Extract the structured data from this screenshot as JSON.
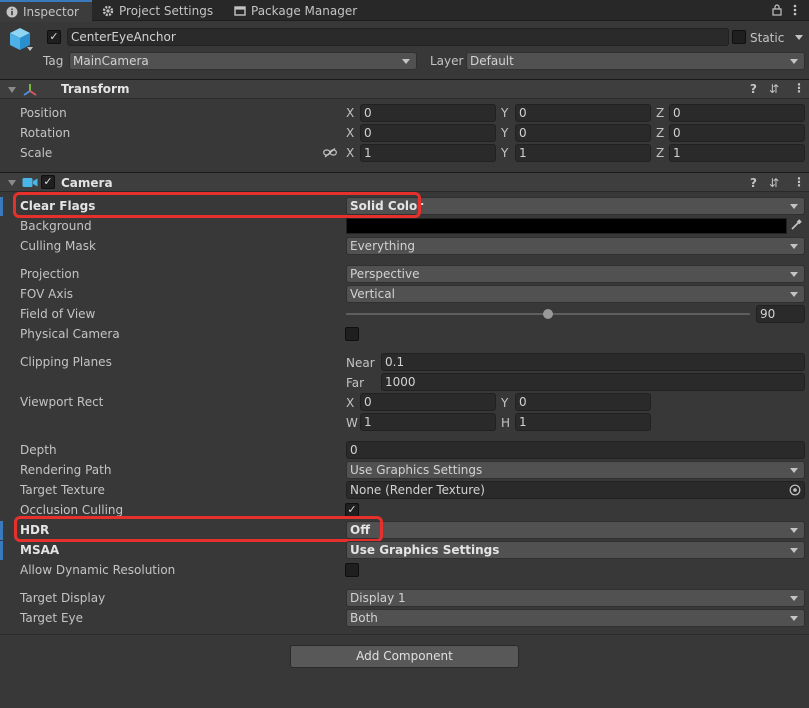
{
  "tabs": [
    {
      "label": "Inspector",
      "icon": "info-icon"
    },
    {
      "label": "Project Settings",
      "icon": "gear-icon"
    },
    {
      "label": "Package Manager",
      "icon": "package-icon"
    }
  ],
  "header": {
    "object_name": "CenterEyeAnchor",
    "active": true,
    "static_label": "Static",
    "tag_label": "Tag",
    "tag_value": "MainCamera",
    "layer_label": "Layer",
    "layer_value": "Default"
  },
  "transform": {
    "title": "Transform",
    "rows": [
      {
        "label": "Position",
        "x": "0",
        "y": "0",
        "z": "0"
      },
      {
        "label": "Rotation",
        "x": "0",
        "y": "0",
        "z": "0"
      },
      {
        "label": "Scale",
        "x": "1",
        "y": "1",
        "z": "1"
      }
    ],
    "axis": {
      "x": "X",
      "y": "Y",
      "z": "Z"
    }
  },
  "camera": {
    "title": "Camera",
    "enabled": true,
    "clear_flags": {
      "label": "Clear Flags",
      "value": "Solid Color"
    },
    "background": {
      "label": "Background",
      "color": "#000000"
    },
    "culling_mask": {
      "label": "Culling Mask",
      "value": "Everything"
    },
    "projection": {
      "label": "Projection",
      "value": "Perspective"
    },
    "fov_axis": {
      "label": "FOV Axis",
      "value": "Vertical"
    },
    "field_of_view": {
      "label": "Field of View",
      "value": "90",
      "slider_fraction": 0.5
    },
    "physical_camera": {
      "label": "Physical Camera",
      "checked": false
    },
    "clipping_planes": {
      "label": "Clipping Planes",
      "near_label": "Near",
      "near": "0.1",
      "far_label": "Far",
      "far": "1000"
    },
    "viewport_rect": {
      "label": "Viewport Rect",
      "x_label": "X",
      "x": "0",
      "y_label": "Y",
      "y": "0",
      "w_label": "W",
      "w": "1",
      "h_label": "H",
      "h": "1"
    },
    "depth": {
      "label": "Depth",
      "value": "0"
    },
    "rendering_path": {
      "label": "Rendering Path",
      "value": "Use Graphics Settings"
    },
    "target_texture": {
      "label": "Target Texture",
      "value": "None (Render Texture)"
    },
    "occlusion_culling": {
      "label": "Occlusion Culling",
      "checked": true
    },
    "hdr": {
      "label": "HDR",
      "value": "Off"
    },
    "msaa": {
      "label": "MSAA",
      "value": "Use Graphics Settings"
    },
    "allow_dynamic_resolution": {
      "label": "Allow Dynamic Resolution",
      "checked": false
    },
    "target_display": {
      "label": "Target Display",
      "value": "Display 1"
    },
    "target_eye": {
      "label": "Target Eye",
      "value": "Both"
    }
  },
  "add_component_label": "Add Component",
  "colors": {
    "highlight": "#e6302c",
    "accent": "#3a79bb",
    "panel": "#383838"
  }
}
